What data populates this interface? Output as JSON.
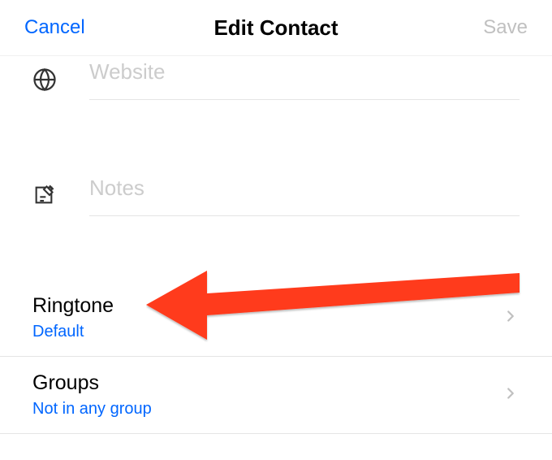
{
  "header": {
    "cancel_label": "Cancel",
    "title": "Edit Contact",
    "save_label": "Save"
  },
  "fields": {
    "website": {
      "placeholder": "Website"
    },
    "notes": {
      "placeholder": "Notes"
    }
  },
  "settings": {
    "ringtone": {
      "label": "Ringtone",
      "value": "Default"
    },
    "groups": {
      "label": "Groups",
      "value": "Not in any group"
    }
  },
  "colors": {
    "accent": "#0066ff",
    "arrow": "#ff3b1f"
  }
}
